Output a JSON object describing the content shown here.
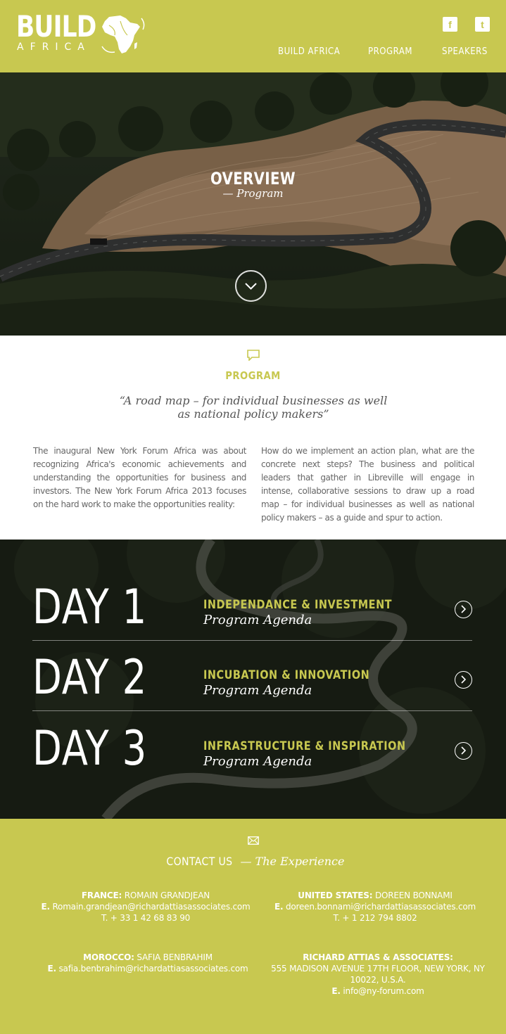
{
  "header": {
    "logo_main": "BUILD",
    "logo_sub": "AFRICA",
    "social": {
      "facebook": "f",
      "twitter": "t"
    },
    "nav": [
      "BUILD AFRICA",
      "PROGRAM",
      "SPEAKERS"
    ],
    "brand_color": "#c8c850"
  },
  "hero": {
    "title": "OVERVIEW",
    "subtitle": "— Program",
    "scroll_icon": "chevron-down-circle-icon"
  },
  "program": {
    "icon": "speech-bubble-icon",
    "title": "PROGRAM",
    "quote_line1": "“A road map – for individual businesses as well",
    "quote_line2": "as national policy makers”",
    "left_text": "The inaugural New York Forum Africa was about recognizing Africa's economic achievements and understanding the opportunities for business and investors. The New York Forum Africa 2013 focuses on the hard work to make the opportunities reality:",
    "right_text": "How do we implement an action plan, what are the concrete next steps? The business and political leaders that gather in Libreville will engage in intense, collaborative sessions to draw up a road map – for individual businesses as well as national policy makers – as a guide and spur to action."
  },
  "days": [
    {
      "label": "DAY 1",
      "theme": "INDEPENDANCE & INVESTMENT",
      "agenda": "Program Agenda"
    },
    {
      "label": "DAY 2",
      "theme": "INCUBATION & INNOVATION",
      "agenda": "Program Agenda"
    },
    {
      "label": "DAY 3",
      "theme": "INFRASTRUCTURE & INSPIRATION",
      "agenda": "Program Agenda"
    }
  ],
  "contact": {
    "icon": "envelope-icon",
    "title": "CONTACT US",
    "dash": "—",
    "subtitle": "The Experience",
    "france": {
      "country": "FRANCE:",
      "name": "ROMAIN GRANDJEAN",
      "e_label": "E.",
      "email": "Romain.grandjean@richardattiasassociates.com",
      "phone": "T. + 33 1 42 68 83 90"
    },
    "us": {
      "country": "UNITED STATES:",
      "name": "DOREEN BONNAMI",
      "e_label": "E.",
      "email": "doreen.bonnami@richardattiasassociates.com",
      "phone": "T. + 1 212 794 8802"
    },
    "morocco": {
      "country": "MOROCCO:",
      "name": "SAFIA BENBRAHIM",
      "e_label": "E.",
      "email": "safia.benbrahim@richardattiasassociates.com"
    },
    "ra": {
      "company": "RICHARD ATTIAS & ASSOCIATES:",
      "address1": "555 MADISON AVENUE 17TH FLOOR, NEW YORK, NY",
      "address2": "10022, U.S.A.",
      "e_label": "E.",
      "email": "info@ny-forum.com"
    }
  }
}
